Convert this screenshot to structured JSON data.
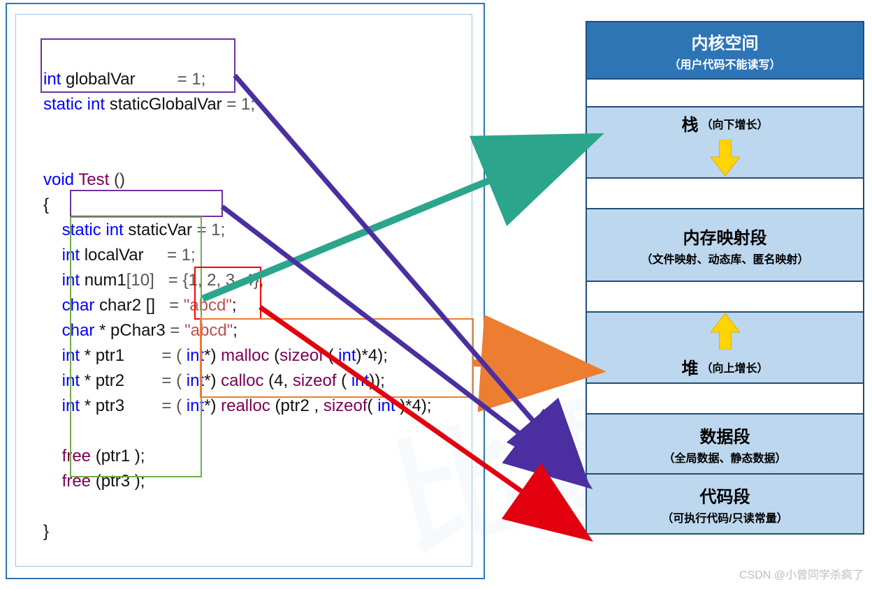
{
  "code": {
    "l1": {
      "kw": "int",
      "name": " globalVar",
      "eq": "= 1;"
    },
    "l2": {
      "kw": "static int",
      "name": " staticGlobalVar",
      "eq": "= 1;"
    },
    "l4": {
      "kw": "void",
      "fn": " Test ",
      "paren": "()"
    },
    "l5": "{",
    "l6": {
      "kw": "static int",
      "name": " staticVar",
      "eq": " = 1;"
    },
    "l7": {
      "kw": "int",
      "name": " localVar",
      "eq": "= 1;"
    },
    "l8": {
      "kw": "int",
      "name": " num1",
      "idx": "[10]",
      "eq": "= {1, 2, 3, 4};"
    },
    "l9": {
      "kw": "char",
      "name": " char2 []",
      "eq": "= ",
      "str": "\"abcd\"",
      ";": ";"
    },
    "l10": {
      "kw": "char",
      "name": " * pChar3",
      "eq": "= ",
      "str": "\"abcd\"",
      ";": ";"
    },
    "l11": {
      "kw": "int",
      "name": " * ptr1",
      "eq": "= ( ",
      "cast": "int",
      "after": "*) ",
      "fn": "malloc",
      "args1": " (",
      "szf": "sizeof",
      "args2": " ( ",
      "t": "int",
      "args3": ")*4);"
    },
    "l12": {
      "kw": "int",
      "name": " * ptr2",
      "eq": "= ( ",
      "cast": "int",
      "after": "*) ",
      "fn": "calloc",
      "args1": " (4, ",
      "szf": "sizeof",
      "args2": " ( ",
      "t": "int",
      "args3": "));"
    },
    "l13": {
      "kw": "int",
      "name": " * ptr3",
      "eq": "= ( ",
      "cast": "int",
      "after": "*) ",
      "fn": "realloc",
      "args1": " (ptr2 , ",
      "szf": "sizeof",
      "args2": "( ",
      "t": "int ",
      "args3": ")*4);"
    },
    "l15": {
      "fn": "free",
      "args": " (ptr1 );"
    },
    "l16": {
      "fn": "free",
      "args": " (ptr3 );"
    },
    "l18": "}"
  },
  "memory": {
    "r0": {
      "title": "内核空间",
      "sub": "（用户代码不能读写）"
    },
    "r1": {
      "title": "",
      "sub": ""
    },
    "r2": {
      "title": "栈",
      "sub": "（向下增长）"
    },
    "r3": {
      "title": "",
      "sub": ""
    },
    "r4": {
      "title": "内存映射段",
      "sub": "（文件映射、动态库、匿名映射）"
    },
    "r5": {
      "title": "",
      "sub": ""
    },
    "r6": {
      "title": "堆",
      "sub": "（向上增长）"
    },
    "r7": {
      "title": "",
      "sub": ""
    },
    "r8": {
      "title": "数据段",
      "sub": "（全局数据、静态数据）"
    },
    "r9": {
      "title": "代码段",
      "sub": "（可执行代码/只读常量）"
    }
  },
  "arrows": {
    "green": {
      "desc": "localVar area → 栈",
      "from": "green-box",
      "to": "stack"
    },
    "orange": {
      "desc": "malloc/calloc/realloc → 堆",
      "from": "orange-box",
      "to": "heap"
    },
    "purple": {
      "desc": "global/static → 数据段",
      "from": "purple-boxes",
      "to": "data-segment"
    },
    "red": {
      "desc": "\"abcd\" literal → 代码段",
      "from": "red-box",
      "to": "code-segment"
    }
  },
  "watermark": "CSDN @小曾同学杀疯了"
}
